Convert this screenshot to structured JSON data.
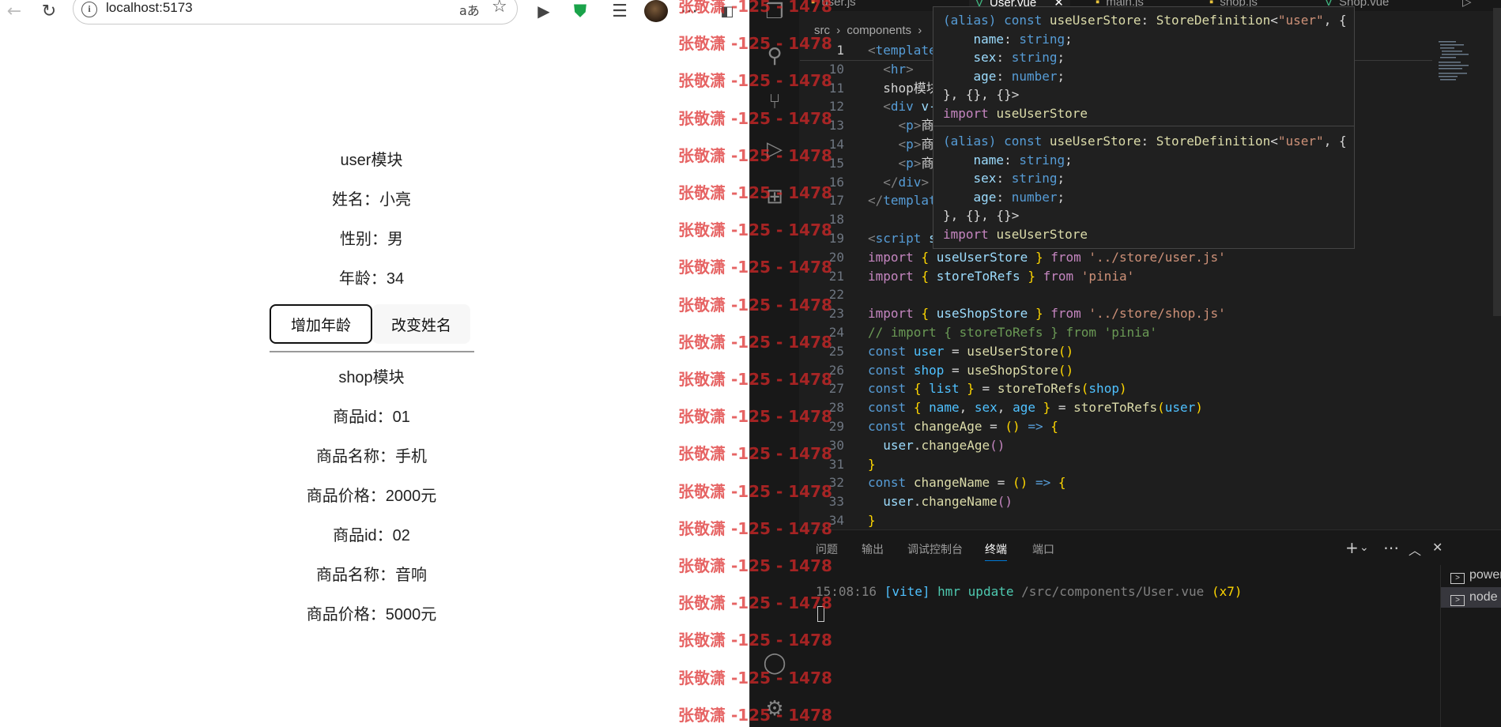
{
  "browser": {
    "url": "localhost:5173",
    "read_aloud_label": "aあ",
    "user": {
      "title": "user模块",
      "name_line": "姓名：小亮",
      "sex_line": "性别：男",
      "age_line": "年龄：34",
      "add_age_label": "增加年龄",
      "change_name_label": "改变姓名"
    },
    "shop": {
      "title": "shop模块",
      "items": [
        {
          "id": "商品id：01",
          "name": "商品名称：手机",
          "price": "商品价格：2000元"
        },
        {
          "id": "商品id：02",
          "name": "商品名称：音响",
          "price": "商品价格：5000元"
        }
      ]
    }
  },
  "watermark": "张敬潇 -125 - 1478",
  "vscode": {
    "tabs": [
      "user.js",
      "User.vue",
      "main.js",
      "shop.js",
      "Shop.vue"
    ],
    "breadcrumb": [
      "src",
      "components"
    ],
    "code": [
      {
        "ln": "1",
        "html": "<span class=\"p\">&lt;</span><span class=\"t\">template</span>"
      },
      {
        "ln": "10",
        "html": "  <span class=\"p\">&lt;</span><span class=\"t\">hr</span><span class=\"p\">&gt;</span>"
      },
      {
        "ln": "11",
        "html": "  shop模块"
      },
      {
        "ln": "12",
        "html": "  <span class=\"p\">&lt;</span><span class=\"t\">div</span> <span class=\"v\">v-</span>"
      },
      {
        "ln": "13",
        "html": "    <span class=\"p\">&lt;</span><span class=\"t\">p</span><span class=\"p\">&gt;</span>商"
      },
      {
        "ln": "14",
        "html": "    <span class=\"p\">&lt;</span><span class=\"t\">p</span><span class=\"p\">&gt;</span>商"
      },
      {
        "ln": "15",
        "html": "    <span class=\"p\">&lt;</span><span class=\"t\">p</span><span class=\"p\">&gt;</span>商"
      },
      {
        "ln": "16",
        "html": "  <span class=\"p\">&lt;/</span><span class=\"t\">div</span><span class=\"p\">&gt;</span>"
      },
      {
        "ln": "17",
        "html": "<span class=\"p\">&lt;/</span><span class=\"t\">templat</span>"
      },
      {
        "ln": "18",
        "html": ""
      },
      {
        "ln": "19",
        "html": "<span class=\"p\">&lt;</span><span class=\"t\">script</span> <span class=\"v\">s</span>"
      },
      {
        "ln": "20",
        "html": "<span class=\"kw\">import</span> <span class=\"y\">{</span> <span class=\"v\">useUserStore</span> <span class=\"y\">}</span> <span class=\"kw\">from</span> <span class=\"s\">'../store/user.js'</span>"
      },
      {
        "ln": "21",
        "html": "<span class=\"kw\">import</span> <span class=\"y\">{</span> <span class=\"v\">storeToRefs</span> <span class=\"y\">}</span> <span class=\"kw\">from</span> <span class=\"s\">'pinia'</span>"
      },
      {
        "ln": "22",
        "html": ""
      },
      {
        "ln": "23",
        "html": "<span class=\"kw\">import</span> <span class=\"y\">{</span> <span class=\"v\">useShopStore</span> <span class=\"y\">}</span> <span class=\"kw\">from</span> <span class=\"s\">'../store/shop.js'</span>"
      },
      {
        "ln": "24",
        "html": "<span class=\"c\">// import { storeToRefs } from 'pinia'</span>"
      },
      {
        "ln": "25",
        "html": "<span class=\"k\">const</span> <span class=\"cn\">user</span> = <span class=\"f\">useUserStore</span><span class=\"y\">()</span>"
      },
      {
        "ln": "26",
        "html": "<span class=\"k\">const</span> <span class=\"cn\">shop</span> = <span class=\"f\">useShopStore</span><span class=\"y\">()</span>"
      },
      {
        "ln": "27",
        "html": "<span class=\"k\">const</span> <span class=\"y\">{</span> <span class=\"cn\">list</span> <span class=\"y\">}</span> = <span class=\"f\">storeToRefs</span><span class=\"y\">(</span><span class=\"cn\">shop</span><span class=\"y\">)</span>"
      },
      {
        "ln": "28",
        "html": "<span class=\"k\">const</span> <span class=\"y\">{</span> <span class=\"cn\">name</span>, <span class=\"cn\">sex</span>, <span class=\"cn\">age</span> <span class=\"y\">}</span> = <span class=\"f\">storeToRefs</span><span class=\"y\">(</span><span class=\"cn\">user</span><span class=\"y\">)</span>"
      },
      {
        "ln": "29",
        "html": "<span class=\"k\">const</span> <span class=\"f\">changeAge</span> = <span class=\"y\">()</span> <span class=\"k\">=&gt;</span> <span class=\"y\">{</span>"
      },
      {
        "ln": "30",
        "html": "  <span class=\"v\">user</span>.<span class=\"f\">changeAge</span><span class=\"kw\">()</span>"
      },
      {
        "ln": "31",
        "html": "<span class=\"y\">}</span>"
      },
      {
        "ln": "32",
        "html": "<span class=\"k\">const</span> <span class=\"f\">changeName</span> = <span class=\"y\">()</span> <span class=\"k\">=&gt;</span> <span class=\"y\">{</span>"
      },
      {
        "ln": "33",
        "html": "  <span class=\"v\">user</span>.<span class=\"f\">changeName</span><span class=\"kw\">()</span>"
      },
      {
        "ln": "34",
        "html": "<span class=\"y\">}</span>"
      }
    ],
    "hover_lines": [
      "<span class=\"k\">(alias)</span> <span class=\"k\">const</span> <span class=\"f\">useUserStore</span>: <span class=\"f\">StoreDefinition</span>&lt;<span class=\"s\">\"user\"</span>, {",
      "    <span class=\"v\">name</span>: <span class=\"k\">string</span>;",
      "    <span class=\"v\">sex</span>: <span class=\"k\">string</span>;",
      "    <span class=\"v\">age</span>: <span class=\"k\">number</span>;",
      "}, {}, {}&gt;",
      "<span class=\"kw\">import</span> <span class=\"f\">useUserStore</span>"
    ],
    "panel_tabs": [
      "问题",
      "输出",
      "调试控制台",
      "终端",
      "端口"
    ],
    "terminal": {
      "line": "<span class=\"p\">15:08:16</span> <span class=\"cn\">[vite]</span> <span style=\"color:#4ec9b0\">hmr update</span> <span class=\"p\">/src/components/User.vue</span> <span class=\"y\">(x7)</span>",
      "terminals": [
        "powershell",
        "node"
      ]
    }
  }
}
